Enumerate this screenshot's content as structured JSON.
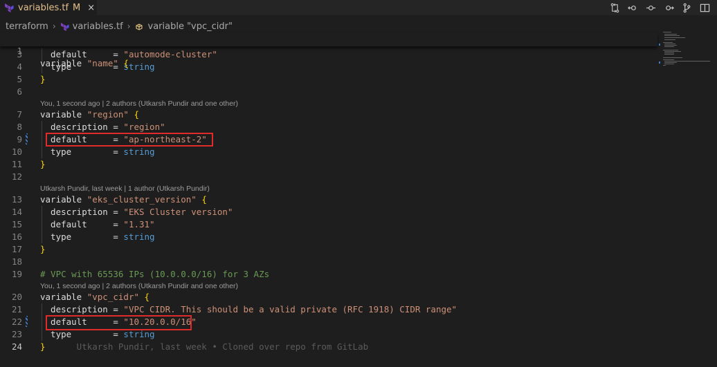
{
  "tab": {
    "filename": "variables.tf",
    "status": "M",
    "close_glyph": "×",
    "icon": "terraform-icon"
  },
  "toolbar": {
    "icons": [
      "git-compare-icon",
      "go-back-icon",
      "timeline-icon",
      "go-forward-icon",
      "branch-icon",
      "split-editor-icon"
    ]
  },
  "breadcrumb": [
    "terraform",
    "variables.tf",
    "variable \"vpc_cidr\""
  ],
  "sticky_line": {
    "number": "1",
    "text": "variable \"name\" {"
  },
  "code_lens": [
    "You, 1 second ago | 2 authors (Utkarsh Pundir and one other)",
    "Utkarsh Pundir, last week | 1 author (Utkarsh Pundir)",
    "You, 1 second ago | 2 authors (Utkarsh Pundir and one other)"
  ],
  "lines": [
    {
      "n": "3",
      "segs": [
        [
          "  default     = ",
          "k"
        ],
        [
          "\"automode-cluster\"",
          "s"
        ]
      ]
    },
    {
      "n": "4",
      "segs": [
        [
          "  type        = ",
          "k"
        ],
        [
          "string",
          "t"
        ]
      ]
    },
    {
      "n": "5",
      "segs": [
        [
          "}",
          "b"
        ]
      ]
    },
    {
      "n": "6",
      "segs": []
    },
    {
      "n": "7",
      "segs": [
        [
          "variable ",
          "k"
        ],
        [
          "\"region\"",
          "s"
        ],
        [
          " ",
          "k"
        ],
        [
          "{",
          "b"
        ]
      ]
    },
    {
      "n": "8",
      "segs": [
        [
          "  description = ",
          "k"
        ],
        [
          "\"region\"",
          "s"
        ]
      ]
    },
    {
      "n": "9",
      "segs": [
        [
          "  default     = ",
          "k"
        ],
        [
          "\"ap-northeast-2\"",
          "s"
        ]
      ]
    },
    {
      "n": "10",
      "segs": [
        [
          "  type        = ",
          "k"
        ],
        [
          "string",
          "t"
        ]
      ]
    },
    {
      "n": "11",
      "segs": [
        [
          "}",
          "b"
        ]
      ]
    },
    {
      "n": "12",
      "segs": []
    },
    {
      "n": "13",
      "segs": [
        [
          "variable ",
          "k"
        ],
        [
          "\"eks_cluster_version\"",
          "s"
        ],
        [
          " ",
          "k"
        ],
        [
          "{",
          "b"
        ]
      ]
    },
    {
      "n": "14",
      "segs": [
        [
          "  description = ",
          "k"
        ],
        [
          "\"EKS Cluster version\"",
          "s"
        ]
      ]
    },
    {
      "n": "15",
      "segs": [
        [
          "  default     = ",
          "k"
        ],
        [
          "\"1.31\"",
          "s"
        ]
      ]
    },
    {
      "n": "16",
      "segs": [
        [
          "  type        = ",
          "k"
        ],
        [
          "string",
          "t"
        ]
      ]
    },
    {
      "n": "17",
      "segs": [
        [
          "}",
          "b"
        ]
      ]
    },
    {
      "n": "18",
      "segs": []
    },
    {
      "n": "19",
      "segs": [
        [
          "# VPC with 65536 IPs (10.0.0.0/16) for 3 AZs",
          "c"
        ]
      ]
    },
    {
      "n": "20",
      "segs": [
        [
          "variable ",
          "k"
        ],
        [
          "\"vpc_cidr\"",
          "s"
        ],
        [
          " ",
          "k"
        ],
        [
          "{",
          "b"
        ]
      ]
    },
    {
      "n": "21",
      "segs": [
        [
          "  description = ",
          "k"
        ],
        [
          "\"VPC CIDR. This should be a valid private (RFC 1918) CIDR range\"",
          "s"
        ]
      ]
    },
    {
      "n": "22",
      "segs": [
        [
          "  default     = ",
          "k"
        ],
        [
          "\"10.20.0.0/16\"",
          "s"
        ]
      ]
    },
    {
      "n": "23",
      "segs": [
        [
          "  type        = ",
          "k"
        ],
        [
          "string",
          "t"
        ]
      ]
    },
    {
      "n": "24",
      "segs": [
        [
          "}",
          "b"
        ]
      ]
    }
  ],
  "blame_inline": "Utkarsh Pundir, last week • Cloned over repo from GitLab",
  "highlight_color": "#e12b2b"
}
